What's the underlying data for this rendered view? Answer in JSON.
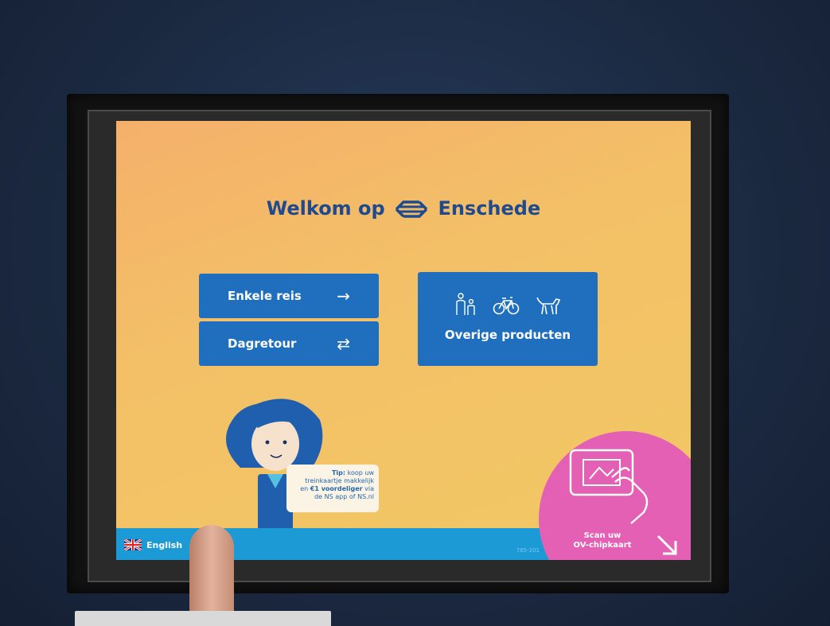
{
  "header": {
    "title_prefix": "Welkom op",
    "title_suffix": "Enschede"
  },
  "buttons": {
    "single_trip": "Enkele reis",
    "day_return": "Dagretour",
    "other_products": "Overige producten"
  },
  "tip": {
    "label": "Tip:",
    "line1": "koop uw",
    "line2": "treinkaartje makkelijk",
    "line3_pre": "en",
    "line3_bold": "€1 voordeliger",
    "line3_post": "via",
    "line4": "de NS app of NS.nl"
  },
  "footer": {
    "language": "English",
    "device_id": "785-201"
  },
  "scan": {
    "line1": "Scan uw",
    "line2": "OV-chipkaart"
  },
  "colors": {
    "ns_blue": "#1f6fbe",
    "title_blue": "#1f4a8f",
    "screen_yellow": "#f2c863",
    "footer_blue": "#1b9ad6",
    "scan_pink": "#e460b4"
  }
}
